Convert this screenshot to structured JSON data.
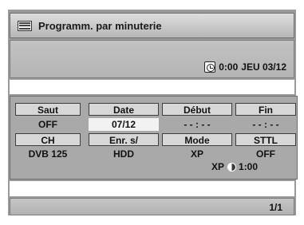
{
  "window": {
    "title": "Programm. par minuterie"
  },
  "clock": {
    "time": "0:00",
    "date": "JEU 03/12"
  },
  "table": {
    "headers_row1": [
      "Saut",
      "Date",
      "Début",
      "Fin"
    ],
    "values_row1": [
      "OFF",
      "07/12",
      "- - : - -",
      "- - : - -"
    ],
    "headers_row2": [
      "CH",
      "Enr. s/",
      "Mode",
      "STTL"
    ],
    "values_row2": [
      "DVB 125",
      "HDD",
      "XP",
      "OFF"
    ],
    "selected_cell": "07/12"
  },
  "remaining": {
    "mode": "XP",
    "time": "1:00"
  },
  "footer": {
    "page": "1/1"
  },
  "icons": {
    "title": "timer-list-icon",
    "clock": "clock-icon",
    "remaining": "half-circle-icon"
  },
  "colors": {
    "panel": "#b6b6b6",
    "header_cell": "#d7d7d7",
    "selected_cell": "#f2f2f2"
  }
}
